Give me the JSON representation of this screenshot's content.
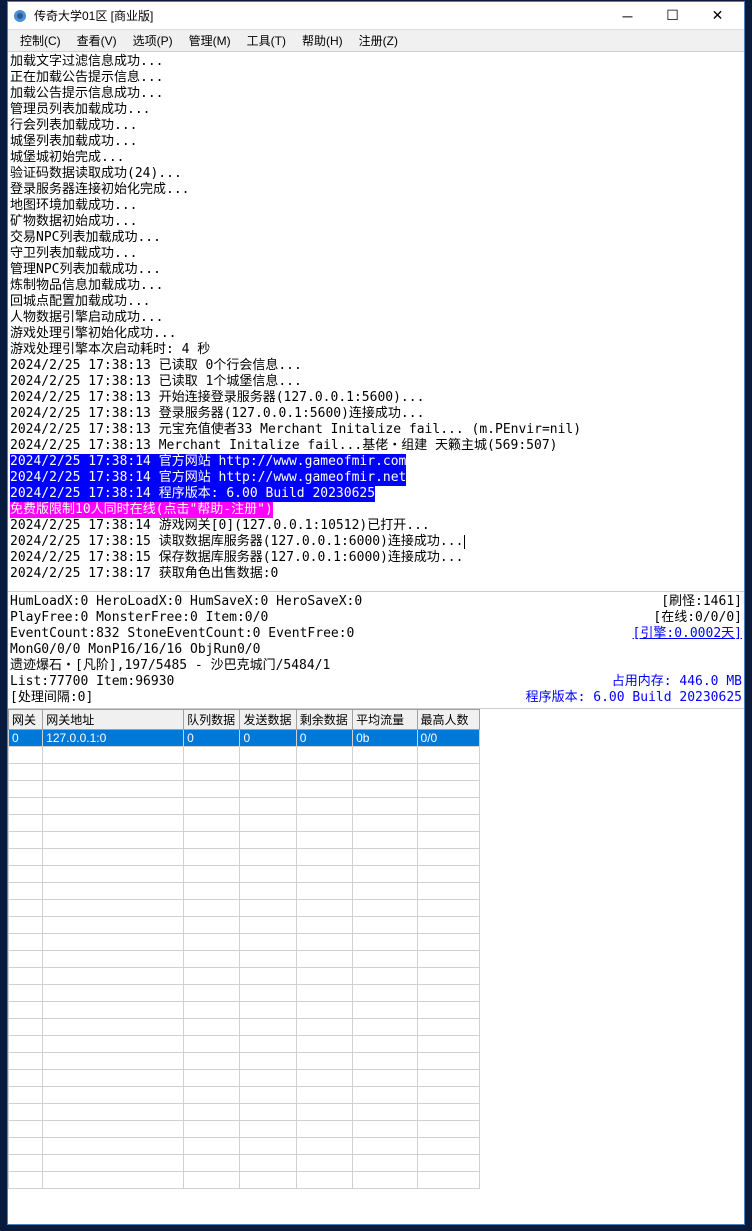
{
  "title": "传奇大学01区  [商业版]",
  "menu": {
    "control": "控制(C)",
    "view": "查看(V)",
    "options": "选项(P)",
    "manage": "管理(M)",
    "tools": "工具(T)",
    "help": "帮助(H)",
    "register": "注册(Z)"
  },
  "log": [
    {
      "t": "加载文字过滤信息成功..."
    },
    {
      "t": "正在加载公告提示信息..."
    },
    {
      "t": "加载公告提示信息成功..."
    },
    {
      "t": "管理员列表加载成功..."
    },
    {
      "t": "行会列表加载成功..."
    },
    {
      "t": "城堡列表加载成功..."
    },
    {
      "t": "城堡城初始完成..."
    },
    {
      "t": "验证码数据读取成功(24)..."
    },
    {
      "t": "登录服务器连接初始化完成..."
    },
    {
      "t": "地图环境加载成功..."
    },
    {
      "t": "矿物数据初始成功..."
    },
    {
      "t": "交易NPC列表加载成功..."
    },
    {
      "t": "守卫列表加载成功..."
    },
    {
      "t": "管理NPC列表加载成功..."
    },
    {
      "t": "炼制物品信息加载成功..."
    },
    {
      "t": "回城点配置加载成功..."
    },
    {
      "t": "人物数据引擎启动成功..."
    },
    {
      "t": "游戏处理引擎初始化成功..."
    },
    {
      "t": "游戏处理引擎本次启动耗时: 4 秒"
    },
    {
      "t": "2024/2/25 17:38:13 已读取 0个行会信息..."
    },
    {
      "t": "2024/2/25 17:38:13 已读取 1个城堡信息..."
    },
    {
      "t": "2024/2/25 17:38:13 开始连接登录服务器(127.0.0.1:5600)..."
    },
    {
      "t": "2024/2/25 17:38:13 登录服务器(127.0.0.1:5600)连接成功..."
    },
    {
      "t": "2024/2/25 17:38:13 元宝充值使者33 Merchant Initalize fail... (m.PEnvir=nil)"
    },
    {
      "t": "2024/2/25 17:38:13 Merchant Initalize fail...基佬・组建 天籁主城(569:507)"
    },
    {
      "t": "2024/2/25 17:38:14 官方网站 http://www.gameofmir.com",
      "c": "hl-blue"
    },
    {
      "t": "2024/2/25 17:38:14 官方网站 http://www.gameofmir.net",
      "c": "hl-blue"
    },
    {
      "t": "2024/2/25 17:38:14 程序版本: 6.00 Build 20230625",
      "c": "hl-blue"
    },
    {
      "t": "免费版限制10人同时在线(点击\"帮助-注册\")",
      "c": "hl-pink"
    },
    {
      "t": "2024/2/25 17:38:14 游戏网关[0](127.0.0.1:10512)已打开..."
    },
    {
      "t": "2024/2/25 17:38:15 读取数据库服务器(127.0.0.1:6000)连接成功...",
      "cursor": true
    },
    {
      "t": "2024/2/25 17:38:15 保存数据库服务器(127.0.0.1:6000)连接成功..."
    },
    {
      "t": "2024/2/25 17:38:17 获取角色出售数据:0"
    }
  ],
  "status": {
    "r1l": "HumLoadX:0 HeroLoadX:0 HumSaveX:0 HeroSaveX:0",
    "r1r": "[刷怪:1461]",
    "r2l": "PlayFree:0 MonsterFree:0 Item:0/0",
    "r2r": "[在线:0/0/0]",
    "r3l": "EventCount:832 StoneEventCount:0 EventFree:0",
    "r3r": "[引擎:0.0002天]",
    "r4l": "MonG0/0/0 MonP16/16/16 ObjRun0/0",
    "r5l": "遗迹爆石・[凡阶],197/5485 - 沙巴克城门/5484/1",
    "r6l": "List:77700 Item:96930",
    "r6r": "占用内存: 446.0 MB",
    "r7l": "[处理间隔:0]",
    "r7r": "程序版本: 6.00 Build 20230625"
  },
  "grid": {
    "headers": [
      "网关",
      "网关地址",
      "队列数据",
      "发送数据",
      "剩余数据",
      "平均流量",
      "最高人数"
    ],
    "row": [
      "0",
      "127.0.0.1:0",
      "0",
      "0",
      "0",
      "0b",
      "0/0"
    ]
  }
}
